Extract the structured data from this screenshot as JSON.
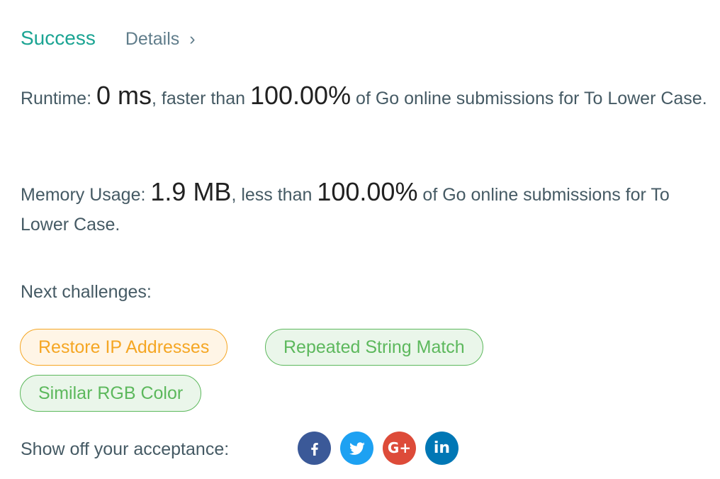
{
  "result": {
    "status": "Success",
    "details_label": "Details",
    "details_chevron": "›"
  },
  "runtime": {
    "label": "Runtime: ",
    "value": "0 ms",
    "mid": ", faster than ",
    "percent": "100.00%",
    "suffix": " of Go online submissions for To Lower Case."
  },
  "memory": {
    "label": "Memory Usage: ",
    "value": "1.9 MB",
    "mid": ", less than ",
    "percent": "100.00%",
    "suffix": " of Go online submissions for To Lower Case."
  },
  "next": {
    "label": "Next challenges:",
    "challenges": [
      {
        "title": "Restore IP Addresses",
        "difficulty_color": "#f5a623"
      },
      {
        "title": "Repeated String Match",
        "difficulty_color": "#5cb85c"
      },
      {
        "title": "Similar RGB Color",
        "difficulty_color": "#5cb85c"
      }
    ]
  },
  "share": {
    "label": "Show off your acceptance:",
    "icons": [
      "facebook-icon",
      "twitter-icon",
      "google-plus-icon",
      "linkedin-icon"
    ],
    "google_text": "G+",
    "linkedin_text": "in"
  },
  "colors": {
    "success": "#1ba493",
    "facebook": "#3b5998",
    "twitter": "#1da1f2",
    "google_plus": "#dd4b39",
    "linkedin": "#0077b5"
  }
}
